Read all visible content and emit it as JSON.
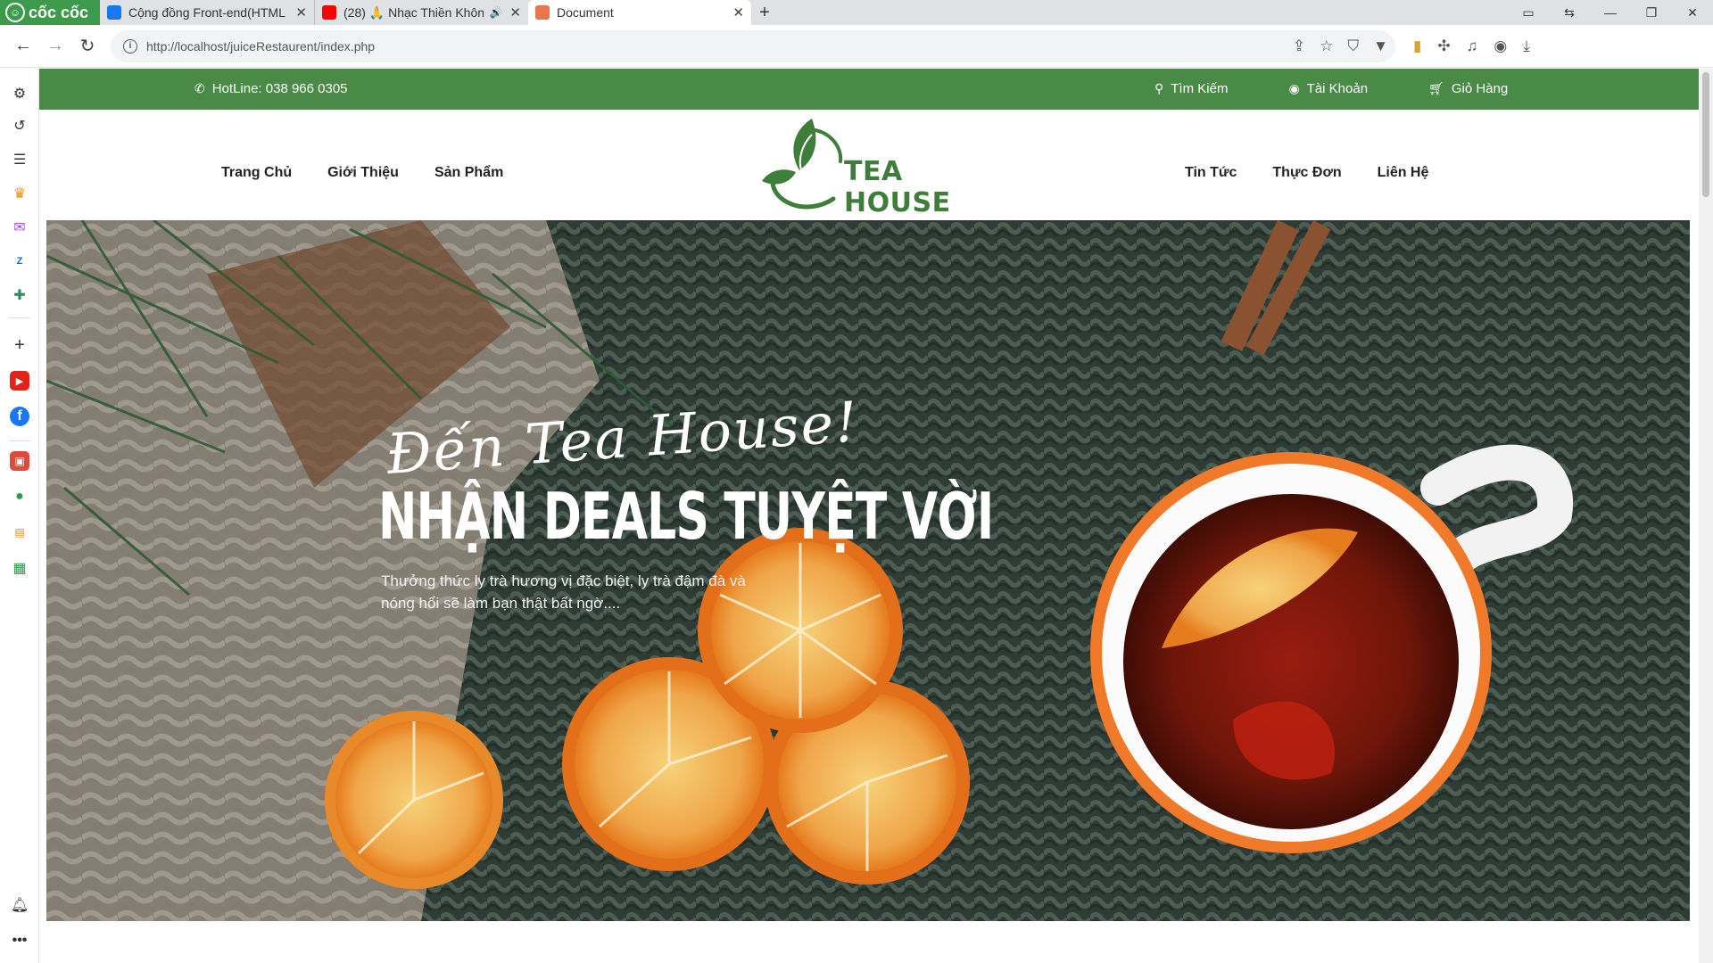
{
  "browser": {
    "brand": "cốc cốc",
    "tabs": [
      {
        "title": "Cộng đồng Front-end(HTML",
        "close": "✕"
      },
      {
        "title": "(28) 🙏 Nhạc Thiền Khôn",
        "close": "✕"
      },
      {
        "title": "Document",
        "close": "✕"
      }
    ],
    "url": "http://localhost/juiceRestaurent/index.php"
  },
  "topbar": {
    "hotline": "HotLine: 038 966 0305",
    "search": "Tìm Kiếm",
    "account": "Tài Khoản",
    "cart": "Giỏ Hàng"
  },
  "nav": {
    "left": [
      "Trang Chủ",
      "Giới Thiệu",
      "Sản Phẩm"
    ],
    "right": [
      "Tin Tức",
      "Thực Đơn",
      "Liên Hệ"
    ]
  },
  "logo": {
    "text": "TEA HOUSE"
  },
  "hero": {
    "script": "Đến Tea House!",
    "title": "NHẬN DEALS TUYỆT VỜI",
    "subtitle": "Thưởng thức ly trà hương vị đặc biệt, ly trà đậm đà và nóng hổi sẽ làm bạn thật bất ngờ...."
  },
  "colors": {
    "topbar": "#4a8a47",
    "logo": "#3f7d3a",
    "tab_active": "#ffffff",
    "brand": "#3c9a4a"
  }
}
